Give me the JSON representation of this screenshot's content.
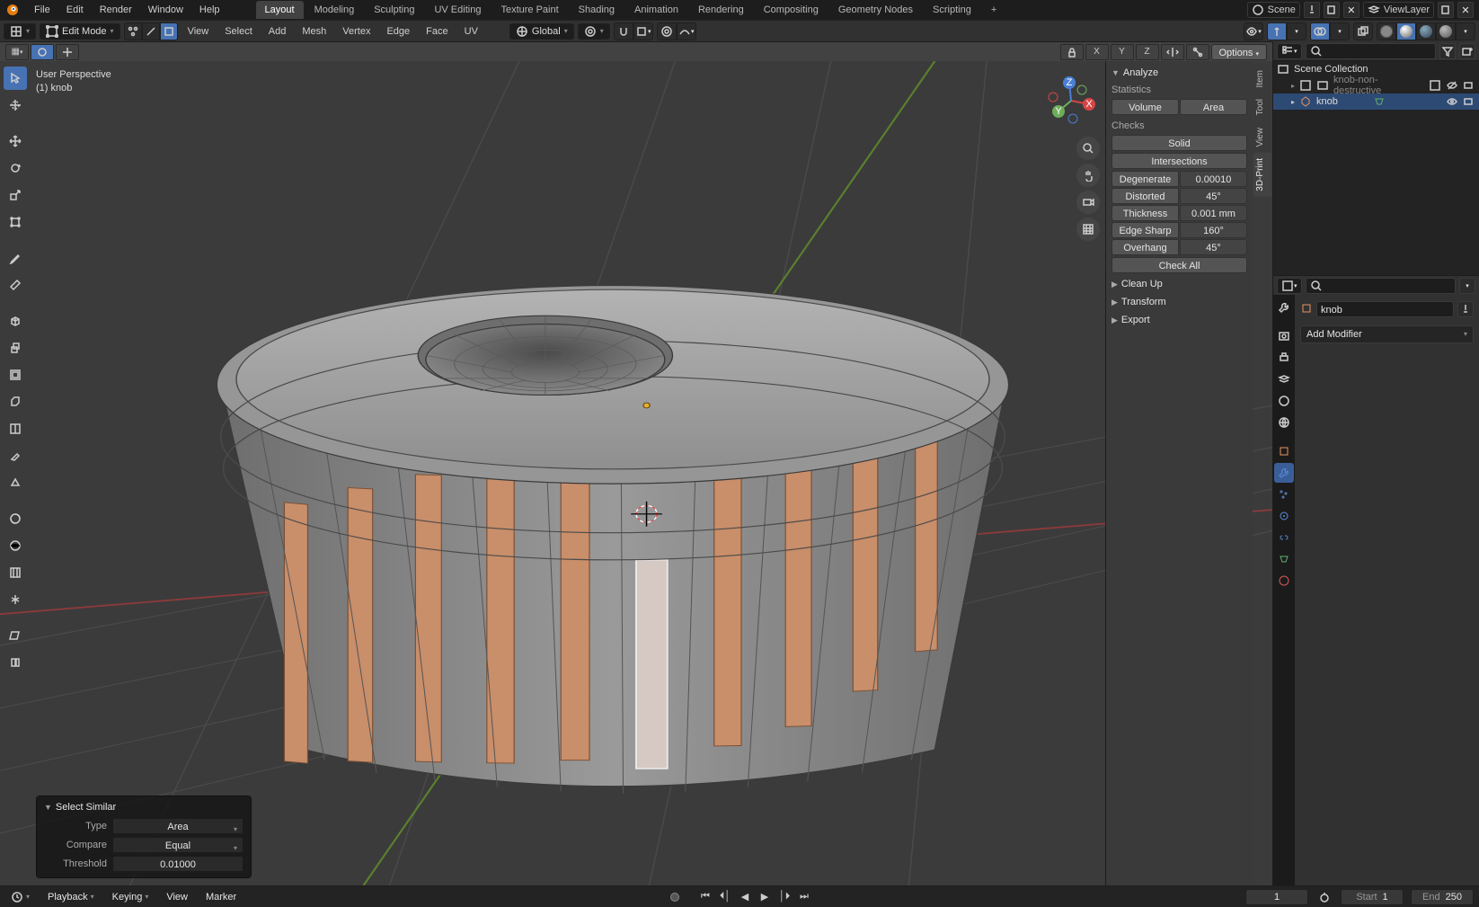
{
  "menu": {
    "items": [
      "File",
      "Edit",
      "Render",
      "Window",
      "Help"
    ]
  },
  "tabs": {
    "items": [
      "Layout",
      "Modeling",
      "Sculpting",
      "UV Editing",
      "Texture Paint",
      "Shading",
      "Animation",
      "Rendering",
      "Compositing",
      "Geometry Nodes",
      "Scripting"
    ],
    "active": 0,
    "add": "+"
  },
  "header_right": {
    "scene_label": "Scene",
    "layer_label": "ViewLayer"
  },
  "modebar": {
    "mode": "Edit Mode",
    "menus": [
      "View",
      "Select",
      "Add",
      "Mesh",
      "Vertex",
      "Edge",
      "Face",
      "UV"
    ],
    "orientation": "Global"
  },
  "gizmo_row": {
    "options_label": "Options",
    "xyz": [
      "X",
      "Y",
      "Z"
    ]
  },
  "overlay": {
    "line1": "User Perspective",
    "line2": "(1) knob"
  },
  "n_panel": {
    "tabs": [
      "Item",
      "Tool",
      "View",
      "3D-Print"
    ],
    "analyze": {
      "title": "Analyze",
      "statistics": "Statistics",
      "volume": "Volume",
      "area": "Area",
      "checks": "Checks",
      "solid": "Solid",
      "intersections": "Intersections",
      "rows": [
        {
          "label": "Degenerate",
          "value": "0.00010"
        },
        {
          "label": "Distorted",
          "value": "45°"
        },
        {
          "label": "Thickness",
          "value": "0.001 mm"
        },
        {
          "label": "Edge Sharp",
          "value": "160°"
        },
        {
          "label": "Overhang",
          "value": "45°"
        }
      ],
      "check_all": "Check All",
      "cleanup": "Clean Up",
      "transform": "Transform",
      "export": "Export"
    }
  },
  "op_panel": {
    "title": "Select Similar",
    "type_lbl": "Type",
    "type_val": "Area",
    "compare_lbl": "Compare",
    "compare_val": "Equal",
    "threshold_lbl": "Threshold",
    "threshold_val": "0.01000"
  },
  "outliner": {
    "root": "Scene Collection",
    "collection": "knob-non-destructive",
    "object": "knob"
  },
  "properties": {
    "object_name": "knob",
    "add_modifier": "Add Modifier"
  },
  "timeline": {
    "menus": {
      "playback": "Playback",
      "keying": "Keying",
      "view": "View",
      "marker": "Marker"
    },
    "current": "1",
    "start_lbl": "Start",
    "start_val": "1",
    "end_lbl": "End",
    "end_val": "250"
  }
}
